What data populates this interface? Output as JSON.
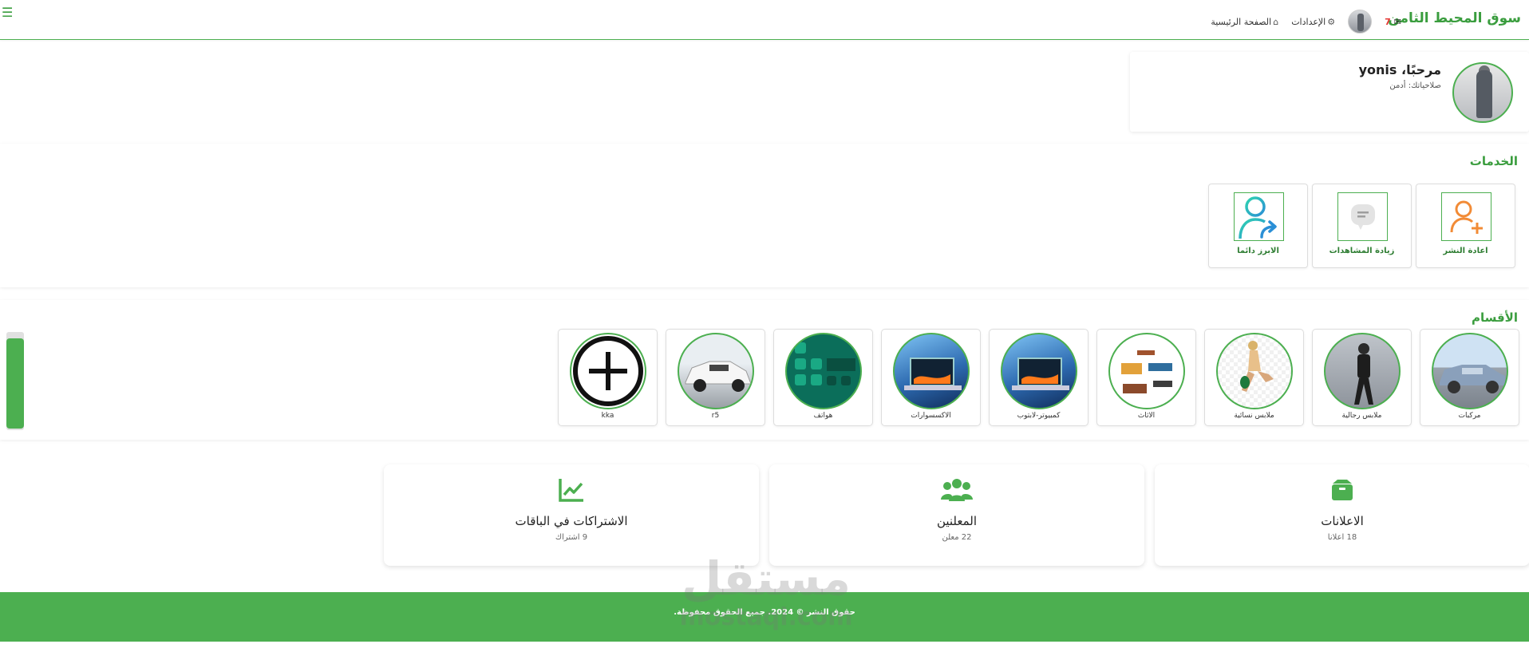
{
  "navbar": {
    "brand": "سوق المحيط الثامن",
    "links": [
      {
        "label": "الصفحة الرئيسية",
        "icon": "home-icon"
      },
      {
        "label": "الإعدادات",
        "icon": "gear-icon"
      }
    ],
    "mail_count": "7",
    "menu_icon": "hamburger-icon"
  },
  "profile": {
    "greeting": "مرحبًا، yonis",
    "role": "صلاحياتك: أدمن"
  },
  "services": {
    "title": "الخدمات",
    "items": [
      {
        "label": "اعادة النشر",
        "icon": "user-plus-icon"
      },
      {
        "label": "زيادة المشاهدات",
        "icon": "chat-bubble-icon"
      },
      {
        "label": "الابرز دائما",
        "icon": "user-share-icon"
      }
    ]
  },
  "categories": {
    "title": "الأقسام",
    "items": [
      {
        "label": "مركبات"
      },
      {
        "label": "ملابس رجالية"
      },
      {
        "label": "ملابس نسائية"
      },
      {
        "label": "الاثاث"
      },
      {
        "label": "كمبيوتر-لابتوب"
      },
      {
        "label": "الاكسسوارات"
      },
      {
        "label": "هواتف"
      },
      {
        "label": "r5"
      },
      {
        "label": "kka"
      }
    ]
  },
  "stats": [
    {
      "title": "الاعلانات",
      "sub": "18 اعلانا",
      "icon": "box-icon"
    },
    {
      "title": "المعلنين",
      "sub": "22 معلن",
      "icon": "users-icon"
    },
    {
      "title": "الاشتراكات في الباقات",
      "sub": "9 اشتراك",
      "icon": "chart-line-icon"
    }
  ],
  "footer": {
    "text": "حقوق النشر © 2024. جميع الحقوق محفوظة."
  },
  "watermark": {
    "ar": "مستقل",
    "en": "mostaqi.com"
  },
  "colors": {
    "accent": "#4caf50",
    "brand": "#3a9d3e"
  }
}
